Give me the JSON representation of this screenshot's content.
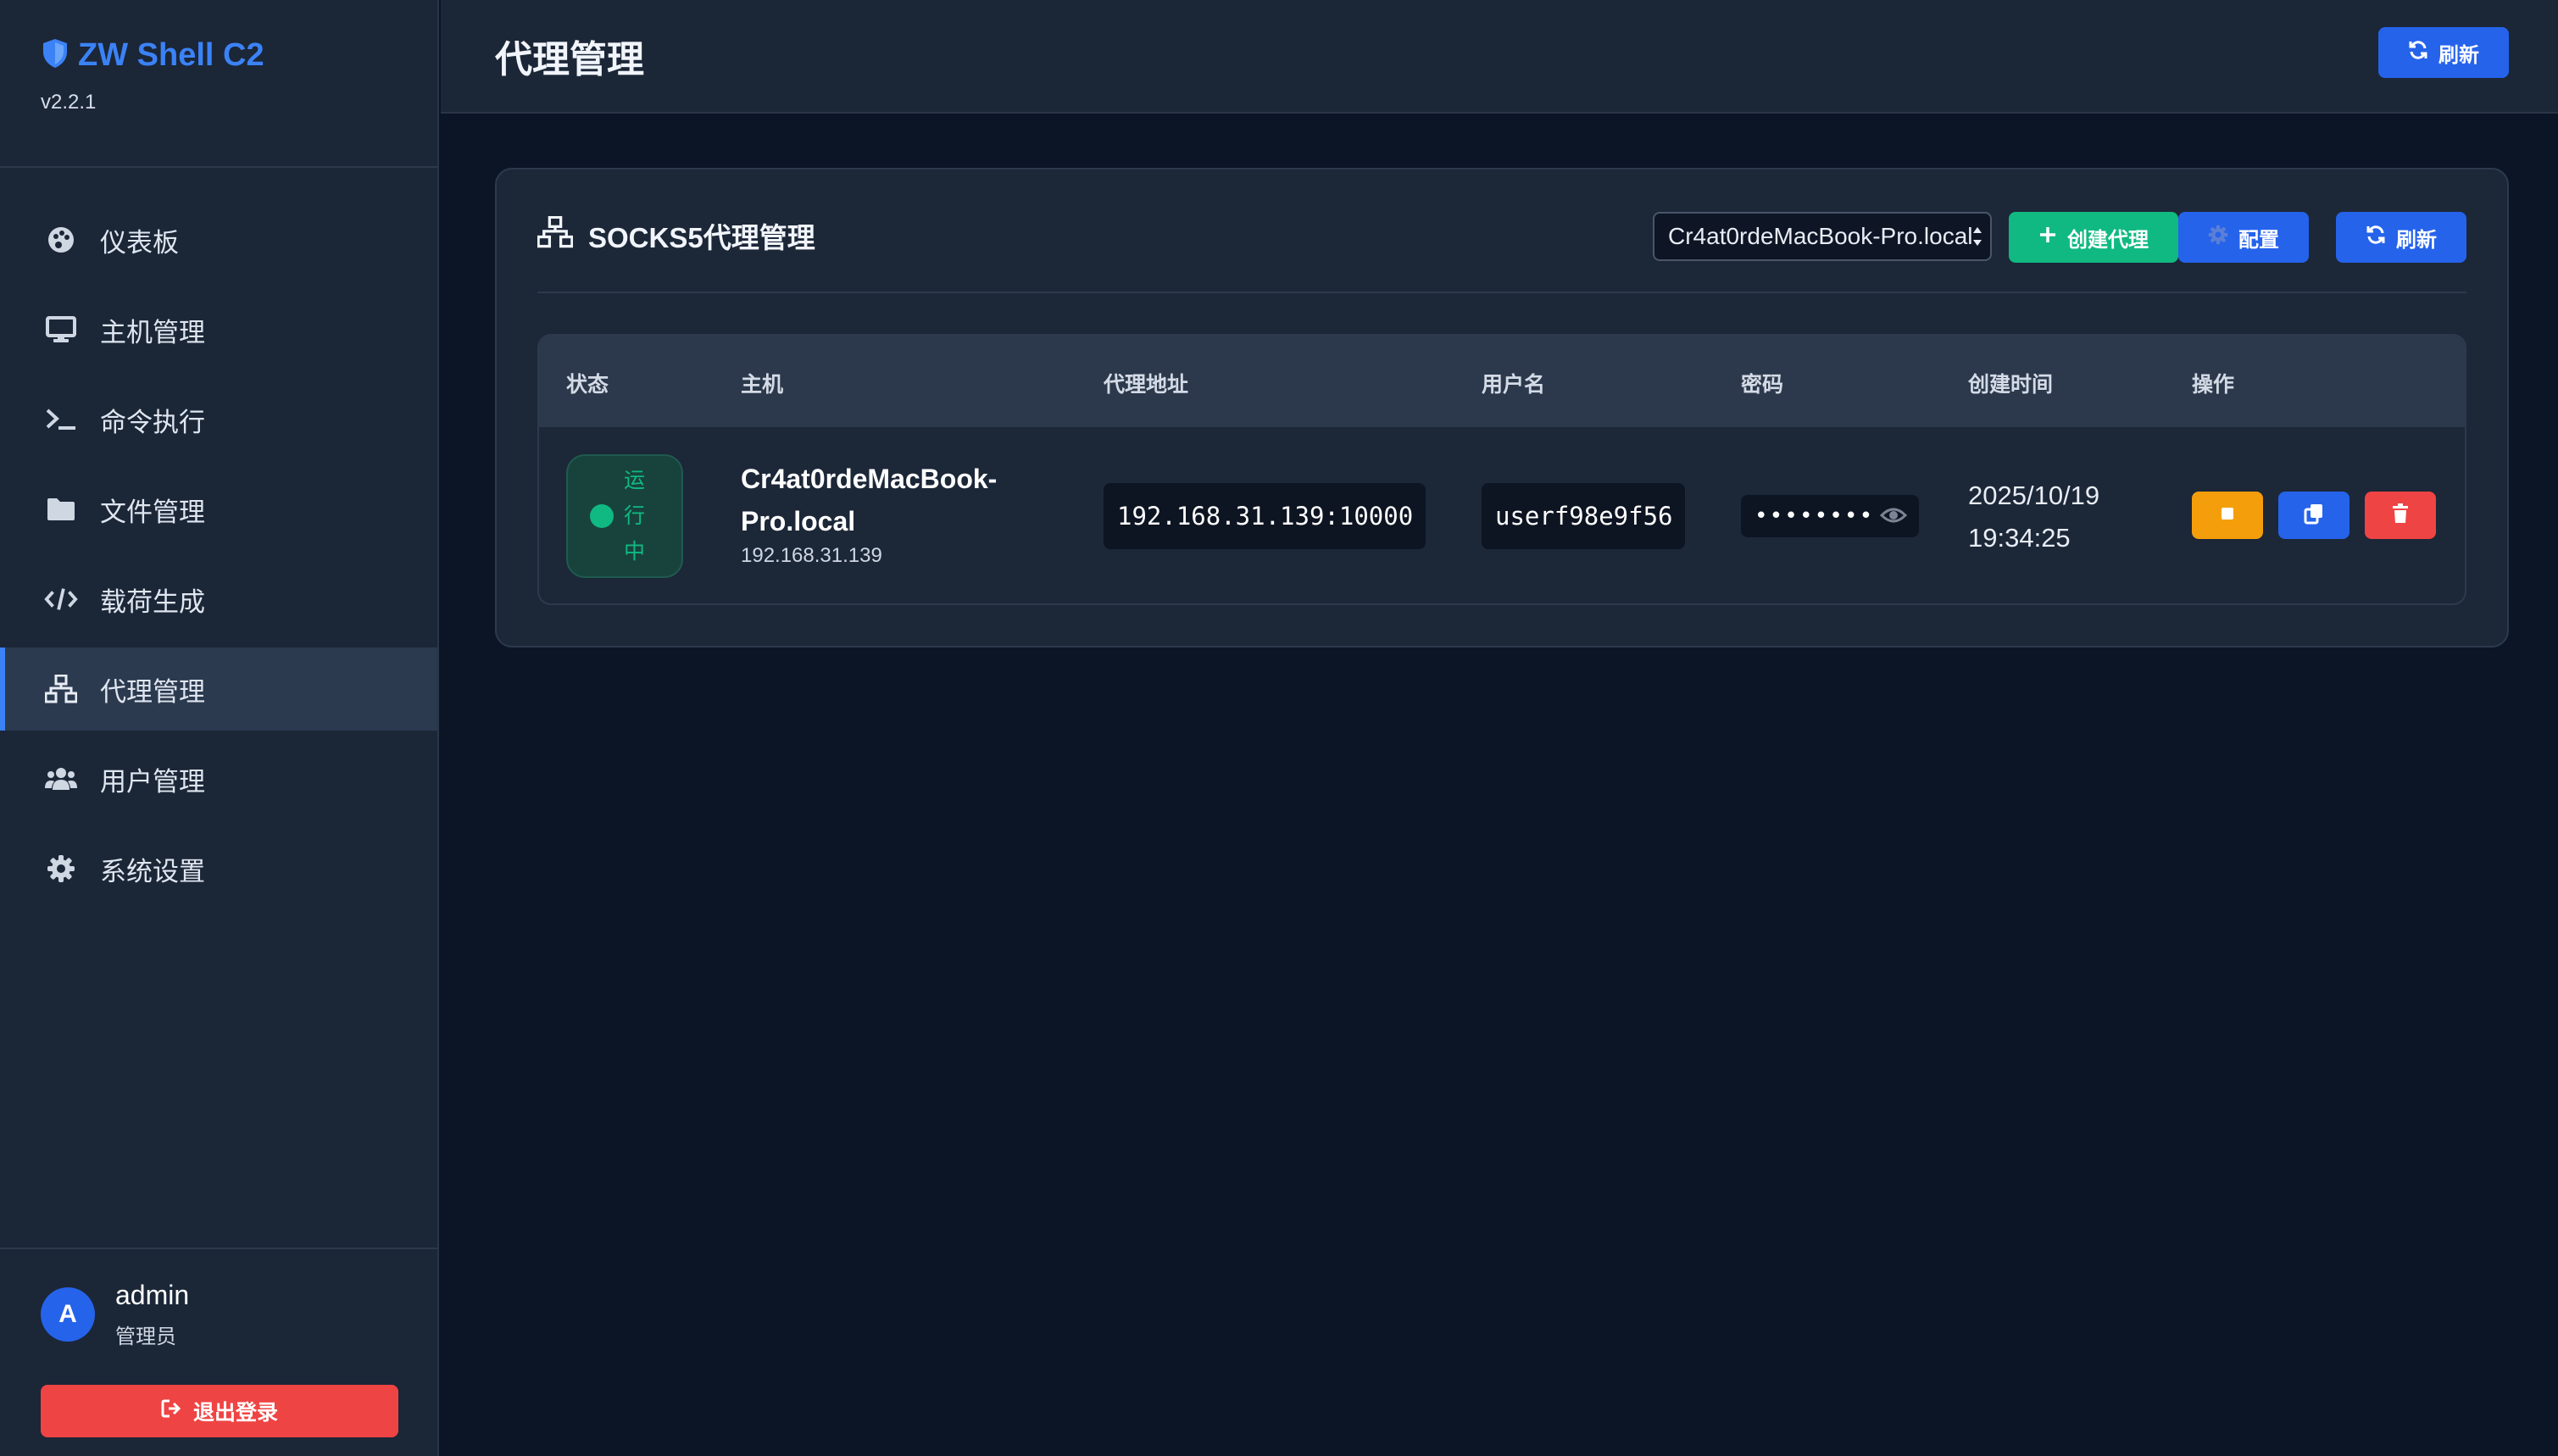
{
  "brand": {
    "title": "ZW Shell C2",
    "version": "v2.2.1"
  },
  "sidebar": {
    "items": [
      {
        "label": "仪表板",
        "icon": "palette-icon"
      },
      {
        "label": "主机管理",
        "icon": "desktop-icon"
      },
      {
        "label": "命令执行",
        "icon": "terminal-icon"
      },
      {
        "label": "文件管理",
        "icon": "folder-icon"
      },
      {
        "label": "载荷生成",
        "icon": "code-icon"
      },
      {
        "label": "代理管理",
        "icon": "network-icon",
        "active": true
      },
      {
        "label": "用户管理",
        "icon": "users-icon"
      },
      {
        "label": "系统设置",
        "icon": "gear-icon"
      }
    ]
  },
  "user": {
    "avatar_letter": "A",
    "name": "admin",
    "role": "管理员",
    "logout_label": "退出登录"
  },
  "header": {
    "title": "代理管理",
    "refresh_label": "刷新"
  },
  "panel": {
    "title": "SOCKS5代理管理",
    "host_select_value": "Cr4at0rdeMacBook-Pro.local",
    "create_label": "创建代理",
    "config_label": "配置",
    "refresh_label": "刷新"
  },
  "table": {
    "columns": [
      "状态",
      "主机",
      "代理地址",
      "用户名",
      "密码",
      "创建时间",
      "操作"
    ],
    "rows": [
      {
        "status": "运行中",
        "host_name": "Cr4at0rdeMacBook-Pro.local",
        "host_ip": "192.168.31.139",
        "address": "192.168.31.139:10000",
        "username": "userf98e9f56",
        "password_masked": "••••••••",
        "created_date": "2025/10/19",
        "created_time": "19:34:25"
      }
    ]
  },
  "colors": {
    "accent": "#2563eb",
    "success": "#10b981",
    "warning": "#f59e0b",
    "danger": "#ef4444",
    "brand": "#3b82f6"
  }
}
